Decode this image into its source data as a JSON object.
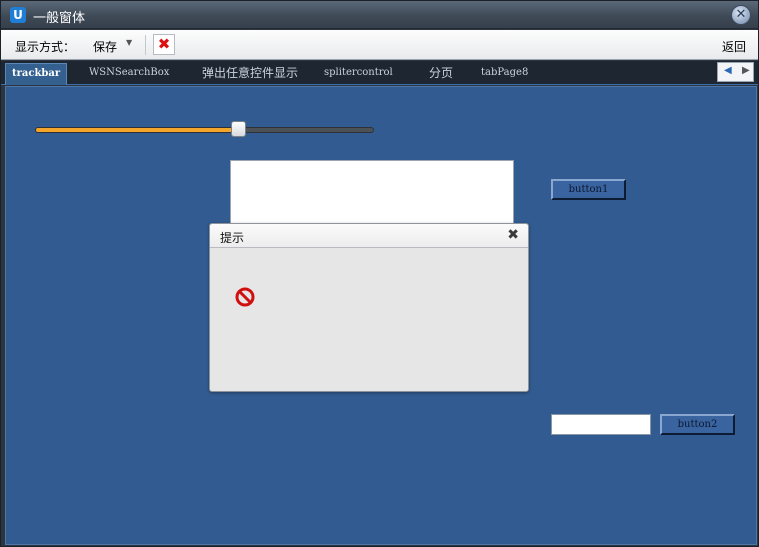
{
  "window": {
    "title": "一般窗体",
    "app_icon_letter": "U"
  },
  "toolbar": {
    "display_mode_label": "显示方式：",
    "save_label": "保存",
    "back_label": "返回"
  },
  "tabs": [
    {
      "label": "trackbar"
    },
    {
      "label": "WSNSearchBox"
    },
    {
      "label": "弹出任意控件显示"
    },
    {
      "label": "splitercontrol"
    },
    {
      "label": "分页"
    },
    {
      "label": "tabPage8"
    }
  ],
  "trackbar": {
    "value_fraction": 0.6
  },
  "buttons": {
    "button1": "button1",
    "button2": "button2"
  },
  "dialog": {
    "title": "提示"
  },
  "colors": {
    "content_bg": "#325c91",
    "slider_fill": "#f4a62a",
    "error_icon": "#d10f0f"
  },
  "icons": {
    "close": "close-icon",
    "cancel": "red-x-icon",
    "error": "no-entry-icon"
  }
}
